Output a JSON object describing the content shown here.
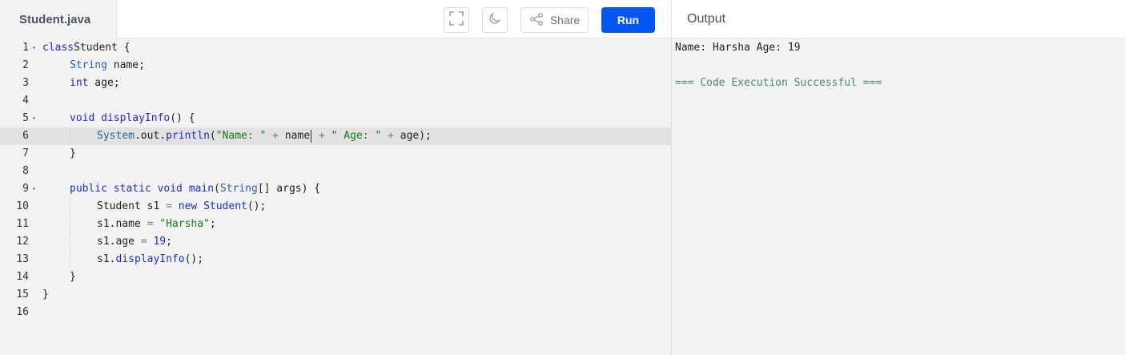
{
  "header": {
    "file_tab": "Student.java",
    "share_label": "Share",
    "run_label": "Run",
    "output_title": "Output"
  },
  "icons": {
    "fullscreen": "fullscreen-icon",
    "theme": "moon-icon",
    "share": "share-icon"
  },
  "colors": {
    "run_button": "#0556f3",
    "keyword": "#1d2bd6",
    "string": "#1a7a1a",
    "success": "#4a8a6a"
  },
  "editor": {
    "active_line": 6,
    "lines": [
      {
        "n": "1",
        "fold": true,
        "indent": 0,
        "tokens": [
          [
            "kw",
            "class"
          ],
          [
            "",
            "Student {"
          ]
        ]
      },
      {
        "n": "2",
        "fold": false,
        "indent": 1,
        "tokens": [
          [
            "typ",
            "String"
          ],
          [
            "",
            " name;"
          ]
        ]
      },
      {
        "n": "3",
        "fold": false,
        "indent": 1,
        "tokens": [
          [
            "kw",
            "int"
          ],
          [
            "",
            " age;"
          ]
        ]
      },
      {
        "n": "4",
        "fold": false,
        "indent": 0,
        "tokens": []
      },
      {
        "n": "5",
        "fold": true,
        "indent": 1,
        "tokens": [
          [
            "kw",
            "void"
          ],
          [
            "",
            " "
          ],
          [
            "fn",
            "displayInfo"
          ],
          [
            "",
            "() {"
          ]
        ]
      },
      {
        "n": "6",
        "fold": false,
        "indent": 2,
        "tokens": [
          [
            "typ",
            "System"
          ],
          [
            "",
            ".out."
          ],
          [
            "fn",
            "println"
          ],
          [
            "",
            "("
          ],
          [
            "str",
            "\"Name: \""
          ],
          [
            "op",
            " + "
          ],
          [
            "",
            "name"
          ],
          [
            "cursor",
            ""
          ],
          [
            "op",
            " + "
          ],
          [
            "str",
            "\" Age: \""
          ],
          [
            "op",
            " + "
          ],
          [
            "",
            "age);"
          ]
        ]
      },
      {
        "n": "7",
        "fold": false,
        "indent": 1,
        "tokens": [
          [
            "",
            "}"
          ]
        ]
      },
      {
        "n": "8",
        "fold": false,
        "indent": 0,
        "tokens": []
      },
      {
        "n": "9",
        "fold": true,
        "indent": 1,
        "tokens": [
          [
            "kw",
            "public static void"
          ],
          [
            "",
            " "
          ],
          [
            "fn",
            "main"
          ],
          [
            "",
            "("
          ],
          [
            "typ",
            "String"
          ],
          [
            "",
            "[] args) {"
          ]
        ]
      },
      {
        "n": "10",
        "fold": false,
        "indent": 2,
        "tokens": [
          [
            "",
            "Student s1 "
          ],
          [
            "op",
            "="
          ],
          [
            "",
            " "
          ],
          [
            "kw",
            "new"
          ],
          [
            "",
            " "
          ],
          [
            "fn",
            "Student"
          ],
          [
            "",
            "();"
          ]
        ]
      },
      {
        "n": "11",
        "fold": false,
        "indent": 2,
        "tokens": [
          [
            "",
            "s1.name "
          ],
          [
            "op",
            "="
          ],
          [
            "",
            " "
          ],
          [
            "str",
            "\"Harsha\""
          ],
          [
            "",
            ";"
          ]
        ]
      },
      {
        "n": "12",
        "fold": false,
        "indent": 2,
        "tokens": [
          [
            "",
            "s1.age "
          ],
          [
            "op",
            "="
          ],
          [
            "",
            " "
          ],
          [
            "num",
            "19"
          ],
          [
            "",
            ";"
          ]
        ]
      },
      {
        "n": "13",
        "fold": false,
        "indent": 2,
        "tokens": [
          [
            "",
            "s1."
          ],
          [
            "fn",
            "displayInfo"
          ],
          [
            "",
            "();"
          ]
        ]
      },
      {
        "n": "14",
        "fold": false,
        "indent": 1,
        "tokens": [
          [
            "",
            "}"
          ]
        ]
      },
      {
        "n": "15",
        "fold": false,
        "indent": 0,
        "tokens": [
          [
            "",
            "}"
          ]
        ]
      },
      {
        "n": "16",
        "fold": false,
        "indent": 0,
        "tokens": []
      }
    ]
  },
  "output": {
    "lines": [
      {
        "text": "Name: Harsha Age: 19",
        "kind": "normal"
      },
      {
        "text": "",
        "kind": "normal"
      },
      {
        "text": "=== Code Execution Successful ===",
        "kind": "success"
      }
    ]
  }
}
